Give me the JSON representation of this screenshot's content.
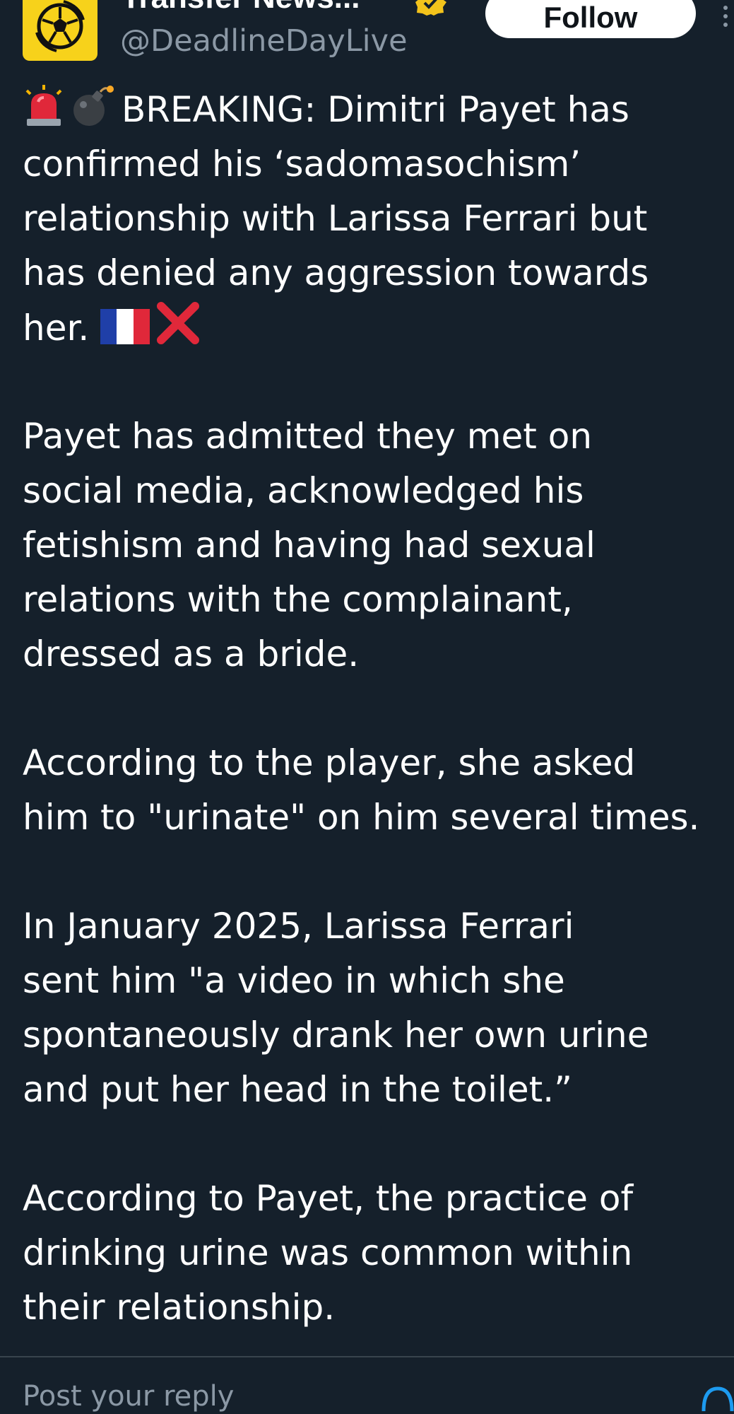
{
  "header": {
    "display_name": "Transfer News...",
    "handle": "@DeadlineDayLive",
    "follow_label": "Follow",
    "avatar_icon": "football-icon",
    "verified_icon": "verified-badge-icon",
    "more_icon": "more-options-icon"
  },
  "tweet": {
    "paragraphs": [
      {
        "lines": [
          "BREAKING: Dimitri Payet has",
          "confirmed his ‘sadomasochism’",
          "relationship with Larissa Ferrari but",
          "has denied any aggression towards",
          "her."
        ]
      },
      {
        "lines": [
          "Payet has admitted they met on",
          "social media, acknowledged his",
          "fetishism and having had sexual",
          "relations with the complainant,",
          "dressed as a bride."
        ]
      },
      {
        "lines": [
          "According to the player, she asked",
          "him to \"urinate\" on him several times."
        ]
      },
      {
        "lines": [
          "In January 2025, Larissa Ferrari",
          "sent him \"a video in which she",
          "spontaneously drank her own urine",
          "and put her head in the toilet.”"
        ]
      },
      {
        "lines": [
          "According to Payet, the practice of",
          "drinking urine was common within",
          "their relationship."
        ]
      }
    ],
    "emojis": {
      "siren": "siren-icon",
      "bomb": "bomb-icon",
      "france_flag": "france-flag-icon",
      "cross": "red-cross-icon"
    }
  },
  "footer": {
    "partial_text": "Post your reply"
  },
  "colors": {
    "background": "#15202b",
    "text": "#ffffff",
    "secondary_text": "#8b98a5",
    "avatar_bg": "#f7d21b",
    "verified": "#f3c31b",
    "divider": "#38444d",
    "accent": "#1d9bf0"
  }
}
